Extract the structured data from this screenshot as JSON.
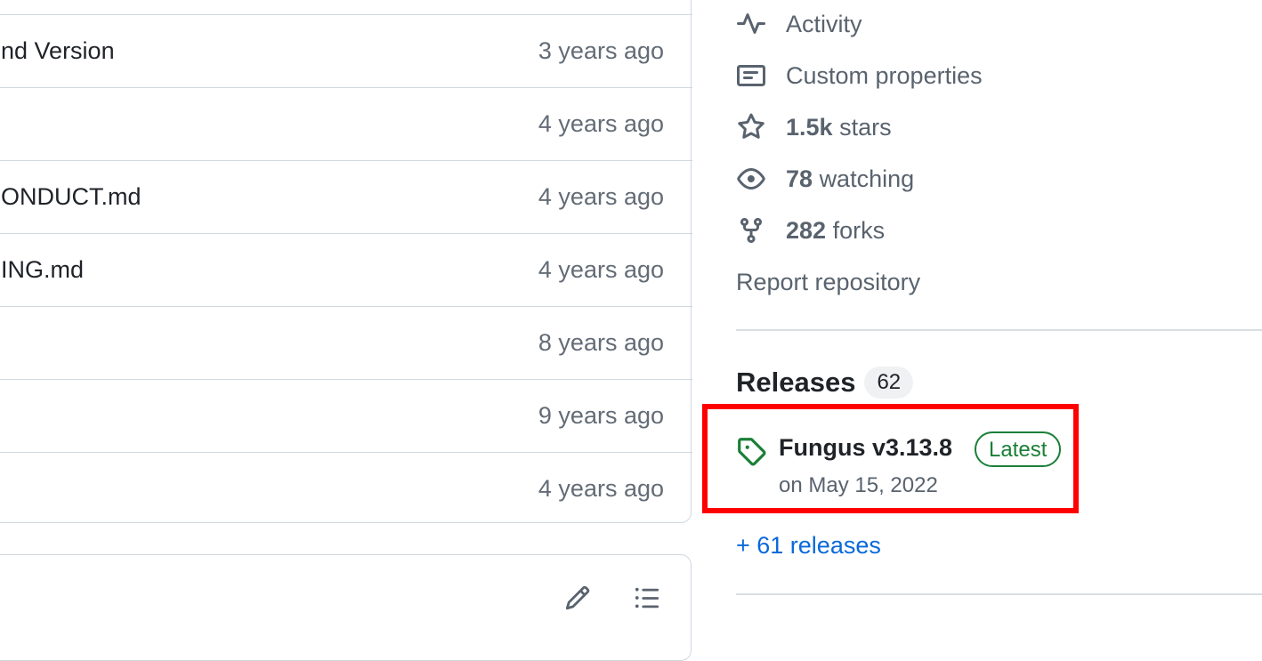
{
  "files": [
    {
      "name": "nd Version",
      "date": "3 years ago"
    },
    {
      "name": "",
      "date": "4 years ago"
    },
    {
      "name": "ONDUCT.md",
      "date": "4 years ago"
    },
    {
      "name": "ING.md",
      "date": "4 years ago"
    },
    {
      "name": "",
      "date": "8 years ago"
    },
    {
      "name": "",
      "date": "9 years ago"
    },
    {
      "name": "",
      "date": "4 years ago"
    }
  ],
  "sidebar": {
    "activity": "Activity",
    "custom_properties": "Custom properties",
    "stars_count": "1.5k",
    "stars_label": "stars",
    "watching_count": "78",
    "watching_label": "watching",
    "forks_count": "282",
    "forks_label": "forks",
    "report": "Report repository"
  },
  "releases": {
    "title": "Releases",
    "count": "62",
    "latest_name": "Fungus v3.13.8",
    "latest_badge": "Latest",
    "latest_date": "on May 15, 2022",
    "more_link": "+ 61 releases"
  },
  "colors": {
    "link": "#0969da",
    "latest_green": "#1a7f37",
    "highlight_red": "#ff0000",
    "muted": "#59636e"
  },
  "icons": [
    "pulse-icon",
    "note-icon",
    "star-icon",
    "eye-icon",
    "repo-forked-icon",
    "tag-icon",
    "pencil-icon",
    "list-unordered-icon"
  ]
}
